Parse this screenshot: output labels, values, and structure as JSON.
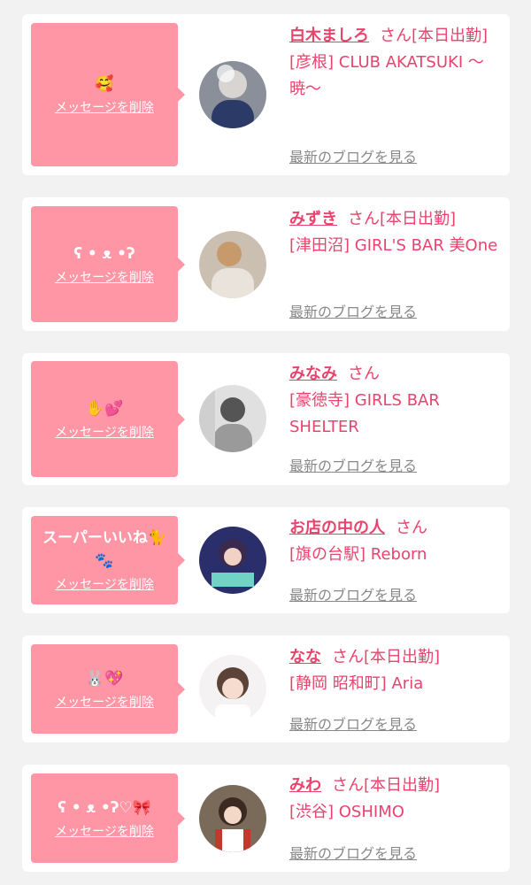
{
  "delete_label": "メッセージを削除",
  "blog_label": "最新のブログを見る",
  "honorific": "さん",
  "entries": [
    {
      "message": "🥰",
      "name": "白木ましろ",
      "status": "[本日出勤]",
      "shop": "[彦根] CLUB AKATSUKI 〜暁〜"
    },
    {
      "message": "ʕ • ᴥ •ʔ",
      "name": "みずき",
      "status": "[本日出勤]",
      "shop": "[津田沼] GIRL'S BAR 美One"
    },
    {
      "message": "✋💕",
      "name": "みなみ",
      "status": "",
      "shop": "[豪徳寺] GIRLS BAR SHELTER"
    },
    {
      "message": "スーパーいいね🐈🐾",
      "name": "お店の中の人",
      "status": "",
      "shop": "[旗の台駅] Reborn"
    },
    {
      "message": "🐰💖",
      "name": "なな",
      "status": "[本日出勤]",
      "shop": "[静岡 昭和町] Aria"
    },
    {
      "message": "ʕ • ᴥ •ʔ♡🎀",
      "name": "みわ",
      "status": "[本日出勤]",
      "shop": "[渋谷] OSHIMO"
    }
  ],
  "colors": {
    "accent": "#e8436d",
    "bubble": "#ff96a6",
    "background": "#f2f2f2",
    "link_gray": "#888888"
  }
}
